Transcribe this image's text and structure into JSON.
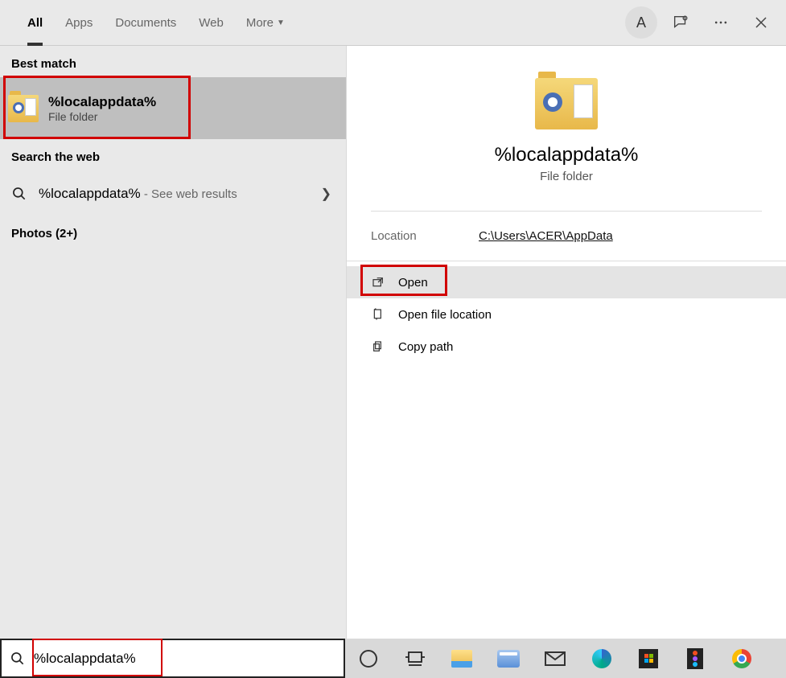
{
  "tabs": {
    "all": "All",
    "apps": "Apps",
    "documents": "Documents",
    "web": "Web",
    "more": "More"
  },
  "avatar_initial": "A",
  "left": {
    "best_match_label": "Best match",
    "bm_title": "%localappdata%",
    "bm_sub": "File folder",
    "search_web_label": "Search the web",
    "web_query": "%localappdata%",
    "web_suffix": " - See web results",
    "photos_label": "Photos (2+)"
  },
  "right": {
    "title": "%localappdata%",
    "sub": "File folder",
    "location_label": "Location",
    "location_value": "C:\\Users\\ACER\\AppData",
    "actions": {
      "open": "Open",
      "open_loc": "Open file location",
      "copy_path": "Copy path"
    }
  },
  "search": {
    "value": "%localappdata%"
  }
}
